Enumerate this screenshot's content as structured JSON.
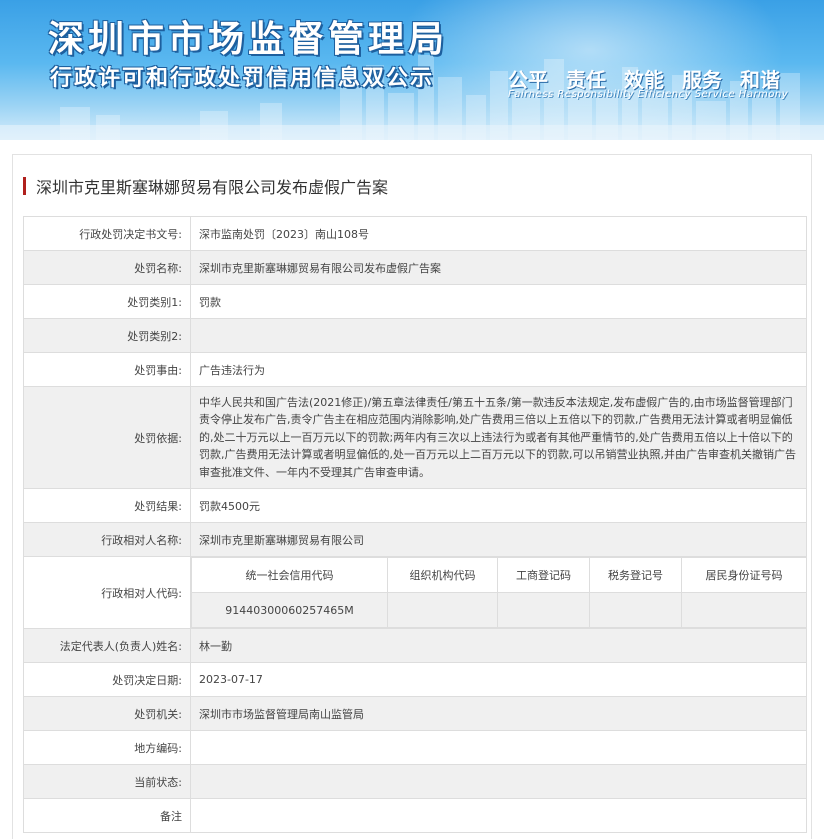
{
  "banner": {
    "title": "深圳市市场监督管理局",
    "subtitle": "行政许可和行政处罚信用信息双公示",
    "values": [
      "公平",
      "责任",
      "效能",
      "服务",
      "和谐"
    ],
    "values_en": "Fairness  Responsibility  Efficiency  Service  Harmony"
  },
  "case_title": "深圳市克里斯塞琳娜贸易有限公司发布虚假广告案",
  "rows": {
    "decision_no": {
      "label": "行政处罚决定书文号:",
      "value": "深市监南处罚〔2023〕南山108号"
    },
    "case_name": {
      "label": "处罚名称:",
      "value": "深圳市克里斯塞琳娜贸易有限公司发布虚假广告案"
    },
    "category1": {
      "label": "处罚类别1:",
      "value": "罚款"
    },
    "category2": {
      "label": "处罚类别2:",
      "value": ""
    },
    "reason": {
      "label": "处罚事由:",
      "value": "广告违法行为"
    },
    "basis": {
      "label": "处罚依据:",
      "value": "中华人民共和国广告法(2021修正)/第五章法律责任/第五十五条/第一款违反本法规定,发布虚假广告的,由市场监督管理部门责令停止发布广告,责令广告主在相应范围内消除影响,处广告费用三倍以上五倍以下的罚款,广告费用无法计算或者明显偏低的,处二十万元以上一百万元以下的罚款;两年内有三次以上违法行为或者有其他严重情节的,处广告费用五倍以上十倍以下的罚款,广告费用无法计算或者明显偏低的,处一百万元以上二百万元以下的罚款,可以吊销营业执照,并由广告审查机关撤销广告审查批准文件、一年内不受理其广告审查申请。"
    },
    "result": {
      "label": "处罚结果:",
      "value": "罚款4500元"
    },
    "party_name": {
      "label": "行政相对人名称:",
      "value": "深圳市克里斯塞琳娜贸易有限公司"
    },
    "party_code": {
      "label": "行政相对人代码:",
      "headers": [
        "统一社会信用代码",
        "组织机构代码",
        "工商登记码",
        "税务登记号",
        "居民身份证号码"
      ],
      "values": [
        "91440300060257465M",
        "",
        "",
        "",
        ""
      ]
    },
    "legal_rep": {
      "label": "法定代表人(负责人)姓名:",
      "value": "林一勤"
    },
    "decision_date": {
      "label": "处罚决定日期:",
      "value": "2023-07-17"
    },
    "authority": {
      "label": "处罚机关:",
      "value": "深圳市市场监督管理局南山监管局"
    },
    "local_code": {
      "label": "地方编码:",
      "value": ""
    },
    "status": {
      "label": "当前状态:",
      "value": ""
    },
    "remark": {
      "label": "备注",
      "value": ""
    }
  }
}
